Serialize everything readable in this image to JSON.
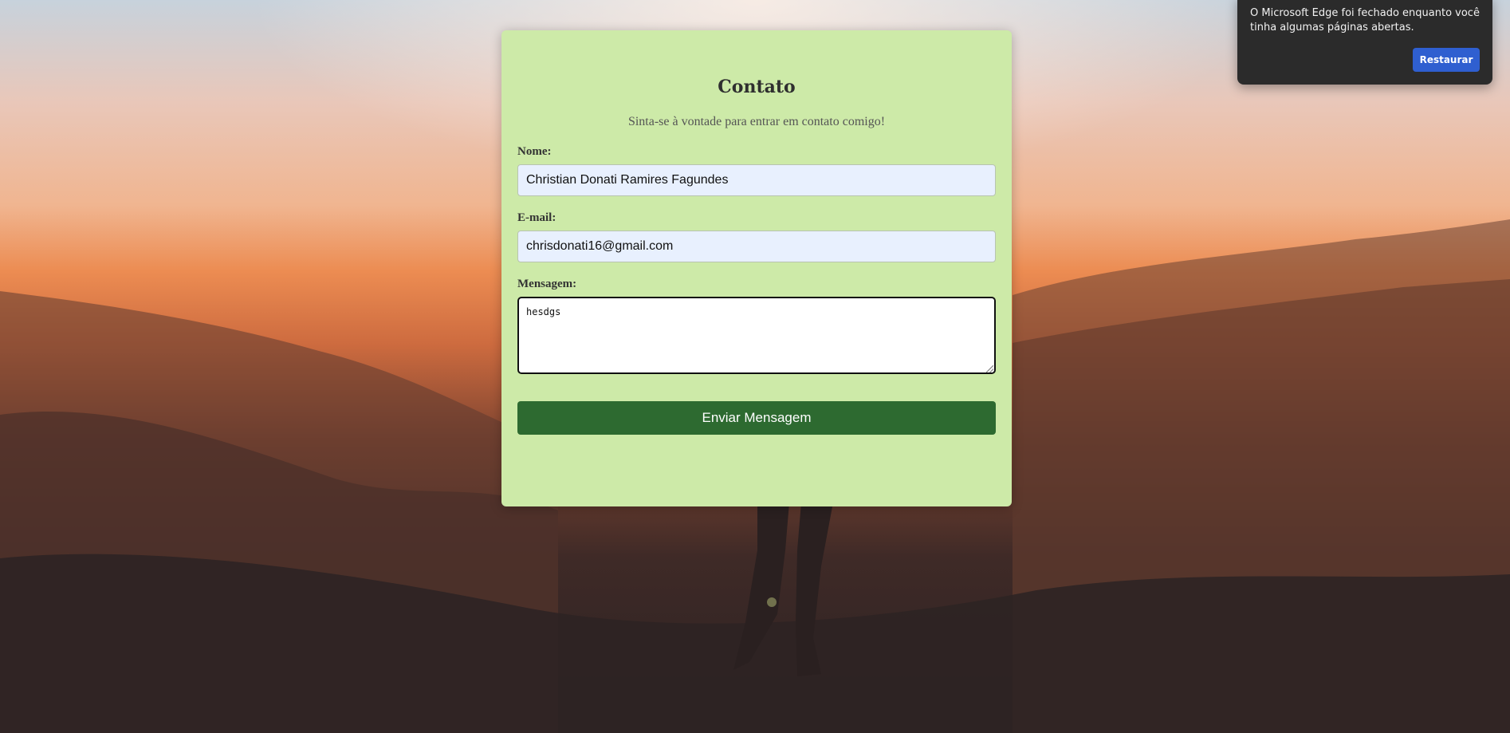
{
  "contact": {
    "title": "Contato",
    "subtitle": "Sinta-se à vontade para entrar em contato comigo!",
    "name_label": "Nome:",
    "name_value": "Christian Donati Ramires Fagundes",
    "email_label": "E-mail:",
    "email_value": "chrisdonati16@gmail.com",
    "message_label": "Mensagem:",
    "message_value": "hesdgs",
    "submit_label": "Enviar Mensagem"
  },
  "edge_toast": {
    "message": "O Microsoft Edge foi fechado enquanto você tinha algumas páginas abertas.",
    "button_label": "Restaurar"
  },
  "colors": {
    "card_background": "#cdeaa8",
    "submit_button": "#2d6a30",
    "toast_button": "#2f5fd0"
  }
}
